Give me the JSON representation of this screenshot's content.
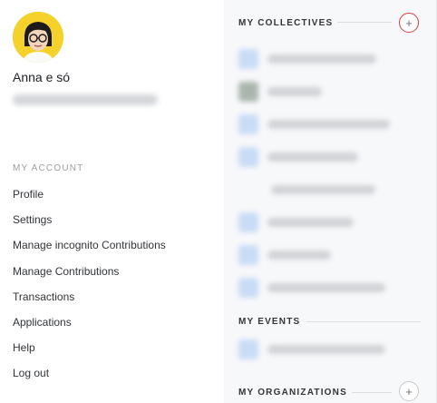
{
  "user": {
    "name": "Anna e só"
  },
  "account_menu": {
    "title": "MY ACCOUNT",
    "items": [
      {
        "label": "Profile"
      },
      {
        "label": "Settings"
      },
      {
        "label": "Manage incognito Contributions"
      },
      {
        "label": "Manage Contributions"
      },
      {
        "label": "Transactions"
      },
      {
        "label": "Applications"
      },
      {
        "label": "Help"
      },
      {
        "label": "Log out"
      }
    ]
  },
  "collectives": {
    "title": "MY COLLECTIVES",
    "add_icon": "plus-icon"
  },
  "events": {
    "title": "MY EVENTS"
  },
  "organizations": {
    "title": "MY ORGANIZATIONS",
    "add_icon": "plus-icon"
  },
  "colors": {
    "highlight": "#e03a3a",
    "blur_icon_blue": "#c8dcf6",
    "blur_icon_gray": "#a9b6ad"
  }
}
